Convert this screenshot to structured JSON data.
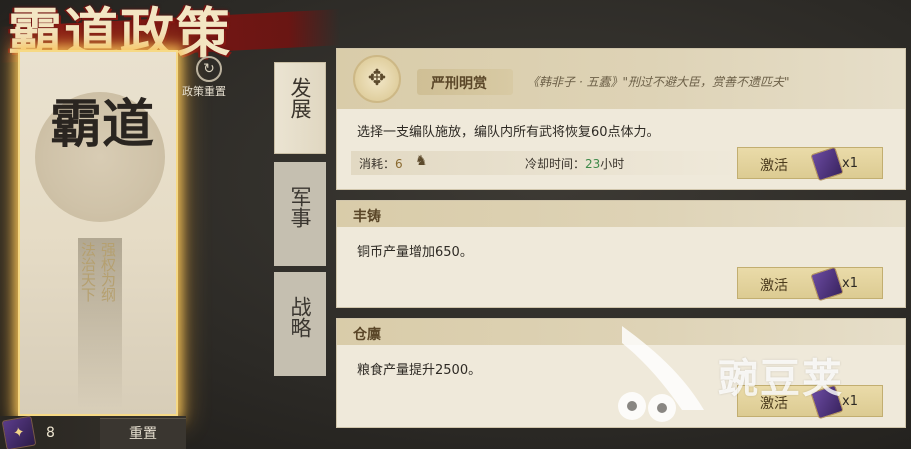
{
  "title": "霸道政策",
  "left_card": {
    "seal_text": "霸道",
    "slogan_line1": "强权为纲",
    "slogan_line2": "法治天下"
  },
  "reset_policy": {
    "icon": "refresh-icon",
    "label": "政策重置"
  },
  "bottom_bar": {
    "item_icon": "token-icon",
    "count": "8",
    "reset_label": "重置"
  },
  "tabs": [
    {
      "label": "发展",
      "selected": true
    },
    {
      "label": "军事",
      "selected": false
    },
    {
      "label": "战略",
      "selected": false
    }
  ],
  "policies": [
    {
      "name": "严刑明赏",
      "quote": "《韩非子 · 五蠹》\"刑过不避大臣，赏善不遗匹夫\"",
      "description": "选择一支编队施放，编队内所有武将恢复60点体力。",
      "cost_label": "消耗：",
      "cost_value": "6",
      "cooldown_label": "冷却时间：",
      "cooldown_value": "23",
      "cooldown_unit": "小时",
      "activate_label": "激活",
      "activate_count": "x1"
    },
    {
      "name": "丰铸",
      "description": "铜币产量增加650。",
      "activate_label": "激活",
      "activate_count": "x1"
    },
    {
      "name": "仓廪",
      "description": "粮食产量提升2500。",
      "activate_label": "激活",
      "activate_count": "x1"
    }
  ],
  "watermark": "豌豆荚",
  "colors": {
    "gold_glow": "#f6d985",
    "panel_bg": "#efe9da",
    "header_bg": "#d9cca9",
    "cooldown_green": "#3e8a4a",
    "title_red": "#8a1a14"
  }
}
